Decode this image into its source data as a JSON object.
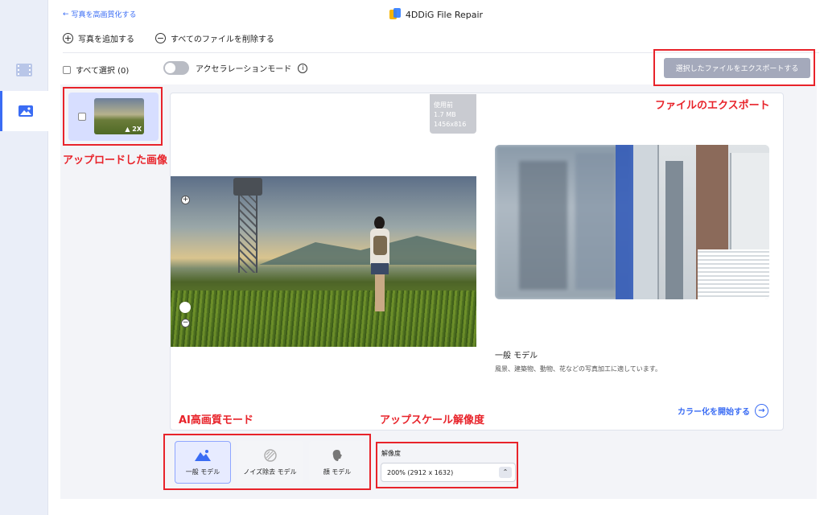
{
  "header": {
    "back_label": "写真を高画質化する",
    "app_title": "4DDiG File Repair"
  },
  "toolbar": {
    "add_photo_label": "写真を追加する",
    "delete_all_label": "すべてのファイルを削除する"
  },
  "selection": {
    "select_all_label": "すべて選択 (0)",
    "acceleration_label": "アクセラレーションモード",
    "export_label": "選択したファイルをエクスポートする"
  },
  "thumbnail": {
    "badge": "2X"
  },
  "preview": {
    "before_tag": [
      "使用前",
      "1.7 MB",
      "1456x816"
    ]
  },
  "model_info": {
    "name": "一般 モデル",
    "description": "風景、建築物、動物、花などの写真加工に適しています。",
    "start_label": "カラー化を開始する"
  },
  "models": [
    {
      "label": "一般 モデル",
      "icon": "mountain-icon",
      "active": true
    },
    {
      "label": "ノイズ除去 モデル",
      "icon": "noise-icon",
      "active": false
    },
    {
      "label": "顔 モデル",
      "icon": "face-icon",
      "active": false
    }
  ],
  "resolution": {
    "label": "解像度",
    "value": "200% (2912 x 1632)"
  },
  "annotations": {
    "export": "ファイルのエクスポート",
    "uploaded": "アップロードした画像",
    "ai_mode": "AI高画質モード",
    "upscale": "アップスケール解像度"
  },
  "colors": {
    "accent": "#3a6cf4",
    "annotation": "#e8232a",
    "export_button": "#a4a9bb"
  }
}
